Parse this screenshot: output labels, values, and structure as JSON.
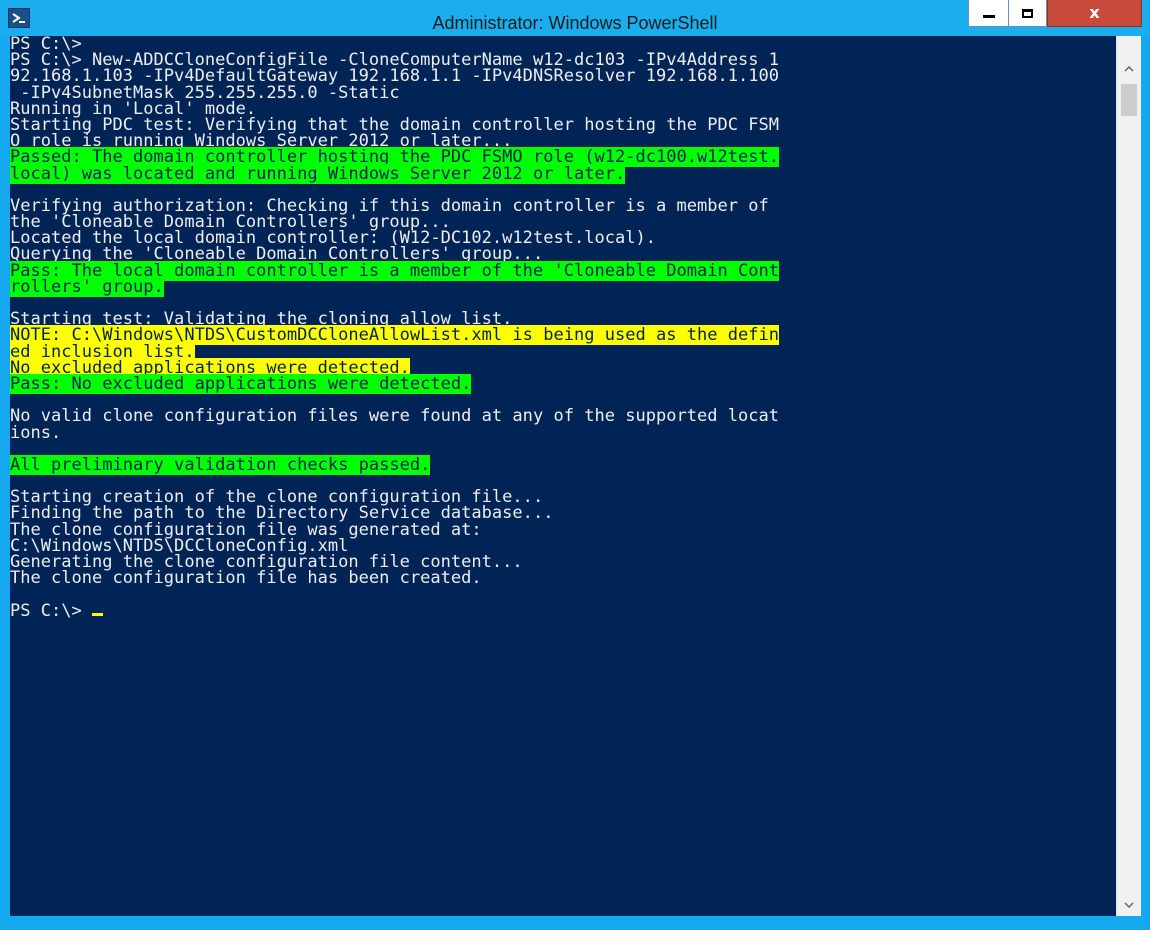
{
  "window": {
    "title": "Administrator: Windows PowerShell",
    "icon": "powershell-icon",
    "controls": {
      "minimize": "minimize-icon",
      "maximize": "maximize-icon",
      "close_label": "x"
    },
    "colors": {
      "titlebar": "#1aaeee",
      "console_bg": "#012456",
      "console_text": "#eeedf0",
      "highlight_green": "#00ff00",
      "highlight_yellow": "#ffff00",
      "close_button": "#c74b3a"
    }
  },
  "console": {
    "lines": [
      {
        "text": "PS C:\\>",
        "style": "normal"
      },
      {
        "text": "PS C:\\> New-ADDCCloneConfigFile -CloneComputerName w12-dc103 -IPv4Address 1",
        "style": "normal"
      },
      {
        "text": "92.168.1.103 -IPv4DefaultGateway 192.168.1.1 -IPv4DNSResolver 192.168.1.100",
        "style": "normal"
      },
      {
        "text": " -IPv4SubnetMask 255.255.255.0 -Static",
        "style": "normal"
      },
      {
        "text": "Running in 'Local' mode.",
        "style": "normal"
      },
      {
        "text": "Starting PDC test: Verifying that the domain controller hosting the PDC FSM",
        "style": "normal"
      },
      {
        "text": "O role is running Windows Server 2012 or later...",
        "style": "normal"
      },
      {
        "text": "Passed: The domain controller hosting the PDC FSMO role (w12-dc100.w12test.",
        "style": "green"
      },
      {
        "text": "local) was located and running Windows Server 2012 or later.",
        "style": "green"
      },
      {
        "text": "",
        "style": "normal"
      },
      {
        "text": "Verifying authorization: Checking if this domain controller is a member of",
        "style": "normal"
      },
      {
        "text": "the 'Cloneable Domain Controllers' group...",
        "style": "normal"
      },
      {
        "text": "Located the local domain controller: (W12-DC102.w12test.local).",
        "style": "normal"
      },
      {
        "text": "Querying the 'Cloneable Domain Controllers' group...",
        "style": "normal"
      },
      {
        "text": "Pass: The local domain controller is a member of the 'Cloneable Domain Cont",
        "style": "green"
      },
      {
        "text": "rollers' group.",
        "style": "green"
      },
      {
        "text": "",
        "style": "normal"
      },
      {
        "text": "Starting test: Validating the cloning allow list.",
        "style": "normal"
      },
      {
        "text": "NOTE: C:\\Windows\\NTDS\\CustomDCCloneAllowList.xml is being used as the defin",
        "style": "yellow"
      },
      {
        "text": "ed inclusion list.",
        "style": "yellow"
      },
      {
        "text": "No excluded applications were detected.",
        "style": "yellow"
      },
      {
        "text": "Pass: No excluded applications were detected.",
        "style": "green"
      },
      {
        "text": "",
        "style": "normal"
      },
      {
        "text": "No valid clone configuration files were found at any of the supported locat",
        "style": "normal"
      },
      {
        "text": "ions.",
        "style": "normal"
      },
      {
        "text": "",
        "style": "normal"
      },
      {
        "text": "All preliminary validation checks passed.",
        "style": "green"
      },
      {
        "text": "",
        "style": "normal"
      },
      {
        "text": "Starting creation of the clone configuration file...",
        "style": "normal"
      },
      {
        "text": "Finding the path to the Directory Service database...",
        "style": "normal"
      },
      {
        "text": "The clone configuration file was generated at:",
        "style": "normal"
      },
      {
        "text": "C:\\Windows\\NTDS\\DCCloneConfig.xml",
        "style": "normal"
      },
      {
        "text": "Generating the clone configuration file content...",
        "style": "normal"
      },
      {
        "text": "The clone configuration file has been created.",
        "style": "normal"
      },
      {
        "text": "",
        "style": "normal"
      },
      {
        "text": "PS C:\\> ",
        "style": "prompt"
      }
    ]
  },
  "scrollbar": {
    "up_icon": "scroll-up-arrow-icon",
    "down_icon": "scroll-down-arrow-icon"
  }
}
